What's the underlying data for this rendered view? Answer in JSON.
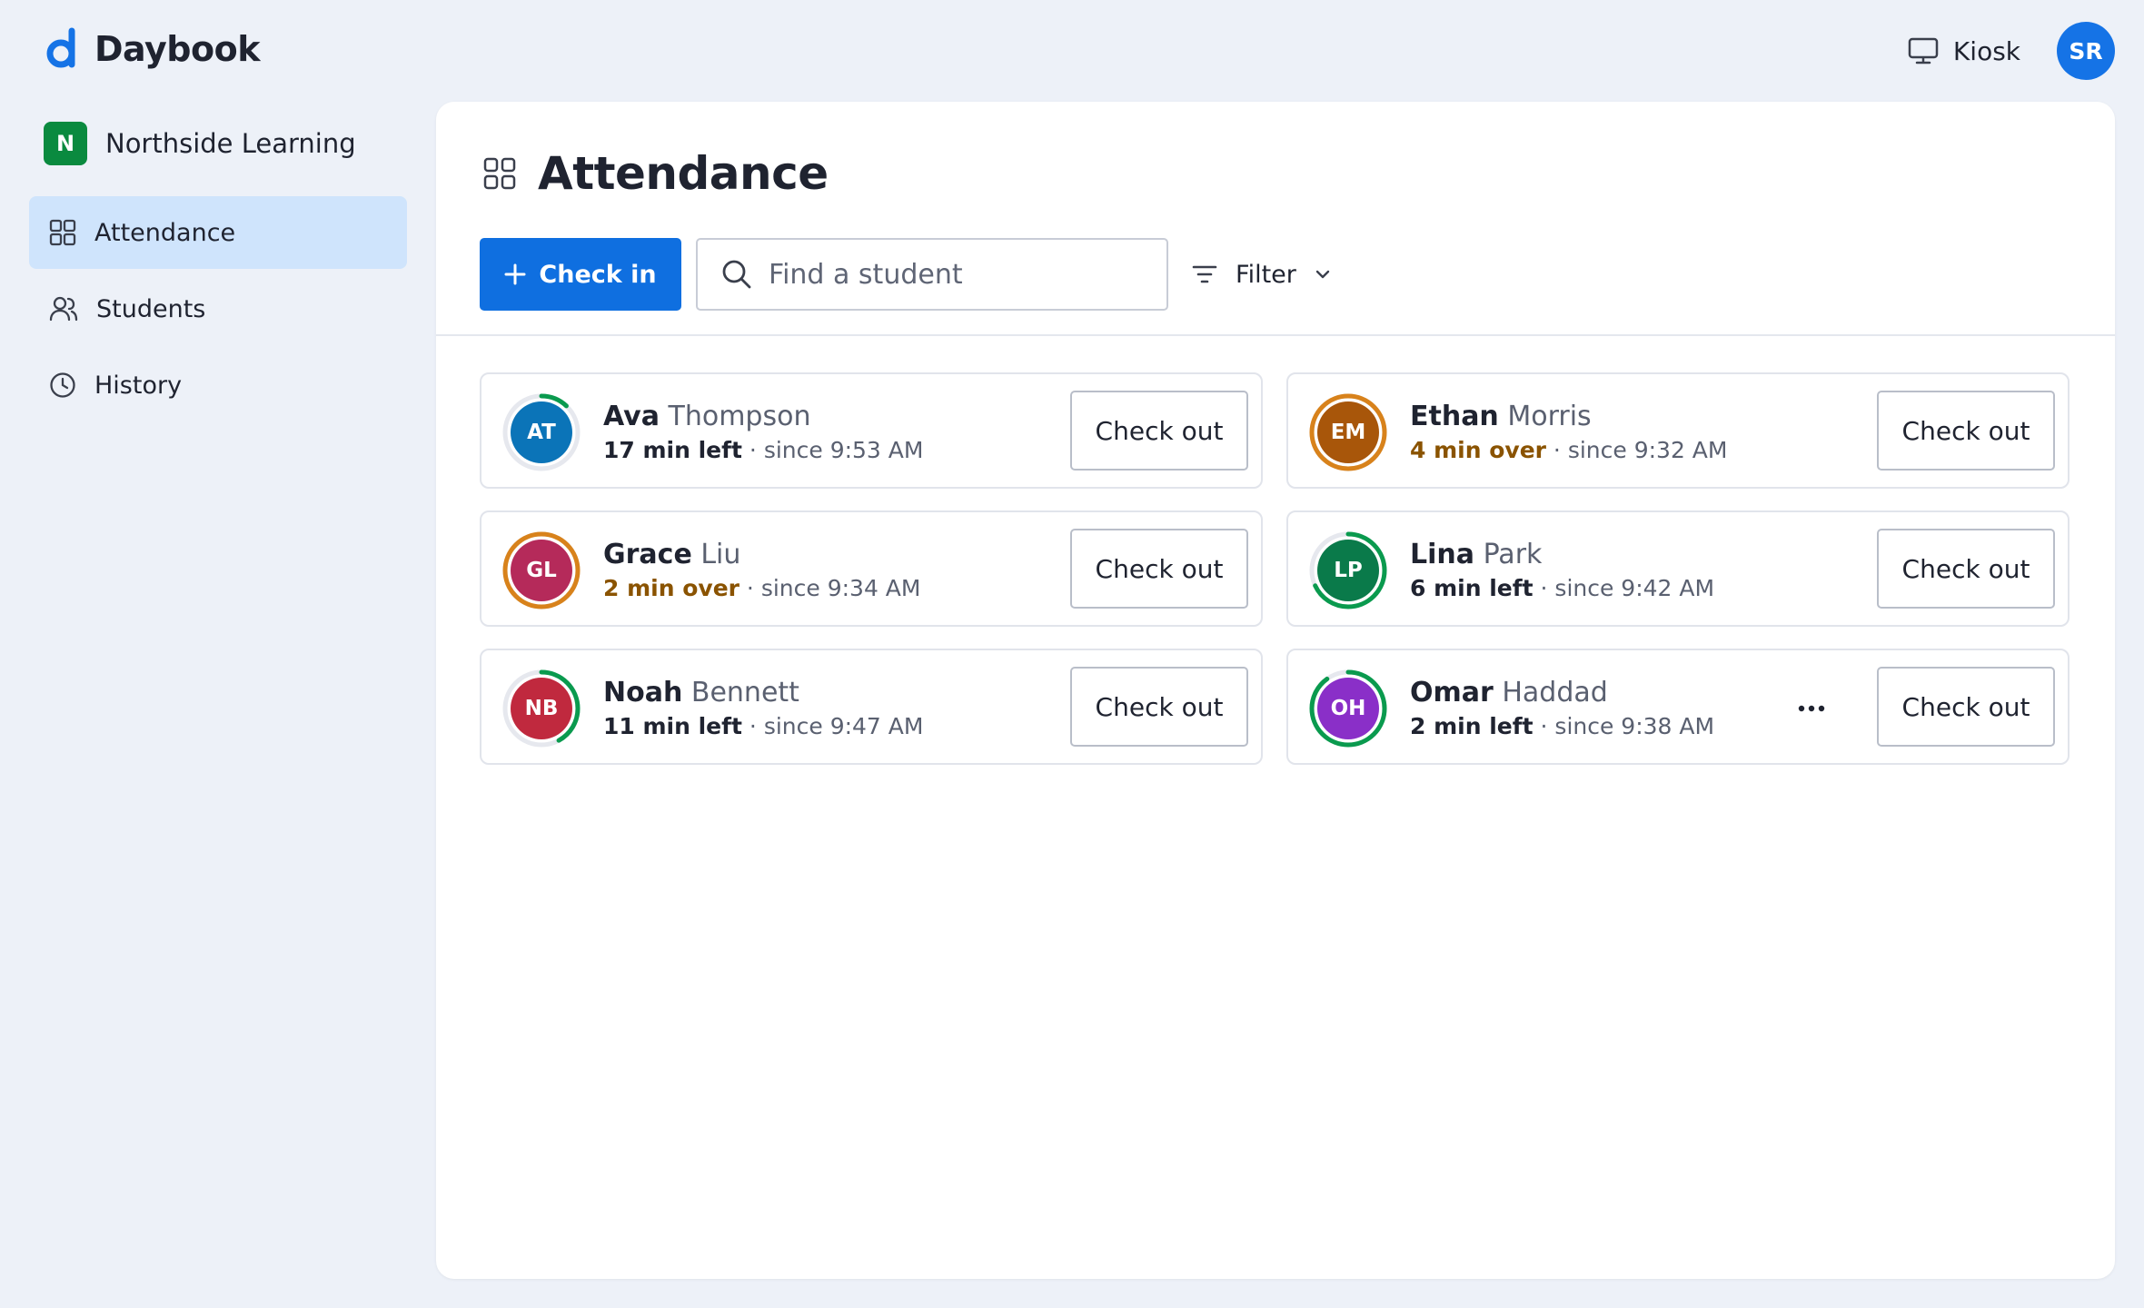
{
  "app": {
    "brand": "Daybook",
    "brand_color": "#1573e6"
  },
  "header": {
    "kiosk_label": "Kiosk",
    "kiosk_icon": "monitor-icon",
    "user_initials": "SR"
  },
  "sidebar": {
    "workspace_initial": "N",
    "workspace_name": "Northside Learning",
    "items": [
      {
        "label": "Attendance",
        "icon": "grid-icon",
        "active": true
      },
      {
        "label": "Students",
        "icon": "users-icon",
        "active": false
      },
      {
        "label": "History",
        "icon": "clock-icon",
        "active": false
      }
    ]
  },
  "main": {
    "title": "Attendance",
    "check_in_label": "Check in",
    "search_placeholder": "Find a student",
    "filter_label": "Filter"
  },
  "students": [
    {
      "initials": "AT",
      "first": "Ava",
      "last": "Thompson",
      "status": "17 min left",
      "since": "since 9:53 AM",
      "over": false,
      "avatar_color": "#0b74b8",
      "ring_color": "#0a9a4e",
      "progress": 0.12,
      "action": "Check out"
    },
    {
      "initials": "EM",
      "first": "Ethan",
      "last": "Morris",
      "status": "4 min over",
      "since": "since 9:32 AM",
      "over": true,
      "avatar_color": "#a8560a",
      "ring_color": "#d8821b",
      "progress": 1.0,
      "action": "Check out"
    },
    {
      "initials": "GL",
      "first": "Grace",
      "last": "Liu",
      "status": "2 min over",
      "since": "since 9:34 AM",
      "over": true,
      "avatar_color": "#b52a5a",
      "ring_color": "#d8821b",
      "progress": 1.0,
      "action": "Check out"
    },
    {
      "initials": "LP",
      "first": "Lina",
      "last": "Park",
      "status": "6 min left",
      "since": "since 9:42 AM",
      "over": false,
      "avatar_color": "#0a7a4a",
      "ring_color": "#0a9a4e",
      "progress": 0.68,
      "action": "Check out"
    },
    {
      "initials": "NB",
      "first": "Noah",
      "last": "Bennett",
      "status": "11 min left",
      "since": "since 9:47 AM",
      "over": false,
      "avatar_color": "#c0293e",
      "ring_color": "#0a9a4e",
      "progress": 0.42,
      "action": "Check out"
    },
    {
      "initials": "OH",
      "first": "Omar",
      "last": "Haddad",
      "status": "2 min left",
      "since": "since 9:38 AM",
      "over": false,
      "avatar_color": "#8a2fc8",
      "ring_color": "#0a9a4e",
      "progress": 0.9,
      "action": "Check out",
      "has_more": true
    }
  ]
}
